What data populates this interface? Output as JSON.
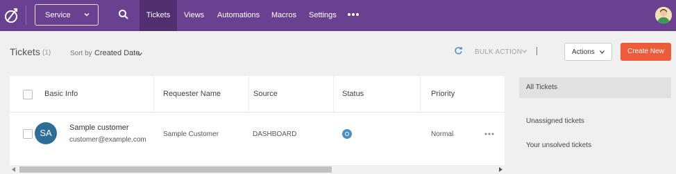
{
  "nav": {
    "service_label": "Service",
    "tabs": [
      {
        "label": "Tickets"
      },
      {
        "label": "Views"
      },
      {
        "label": "Automations"
      },
      {
        "label": "Macros"
      },
      {
        "label": "Settings"
      }
    ]
  },
  "header": {
    "title": "Tickets",
    "count": "(1)",
    "sort_label": "Sort by",
    "sort_value": "Created Date",
    "bulk_action": "BULK ACTION",
    "actions_label": "Actions",
    "create_label": "Create New"
  },
  "table": {
    "columns": [
      "Basic Info",
      "Requester Name",
      "Source",
      "Status",
      "Priority"
    ],
    "rows": [
      {
        "initials": "SA",
        "name": "Sample customer",
        "email": "customer@example.com",
        "requester": "Sample Customer",
        "source": "DASHBOARD",
        "priority": "Normal"
      }
    ]
  },
  "sidebar": {
    "items": [
      {
        "label": "All Tickets"
      },
      {
        "label": "Unassigned tickets"
      },
      {
        "label": "Your unsolved tickets"
      }
    ]
  },
  "colors": {
    "brand": "#6a4190",
    "accent": "#ec5b3a",
    "avatar": "#2d6e98",
    "status": "#4a90c8"
  }
}
